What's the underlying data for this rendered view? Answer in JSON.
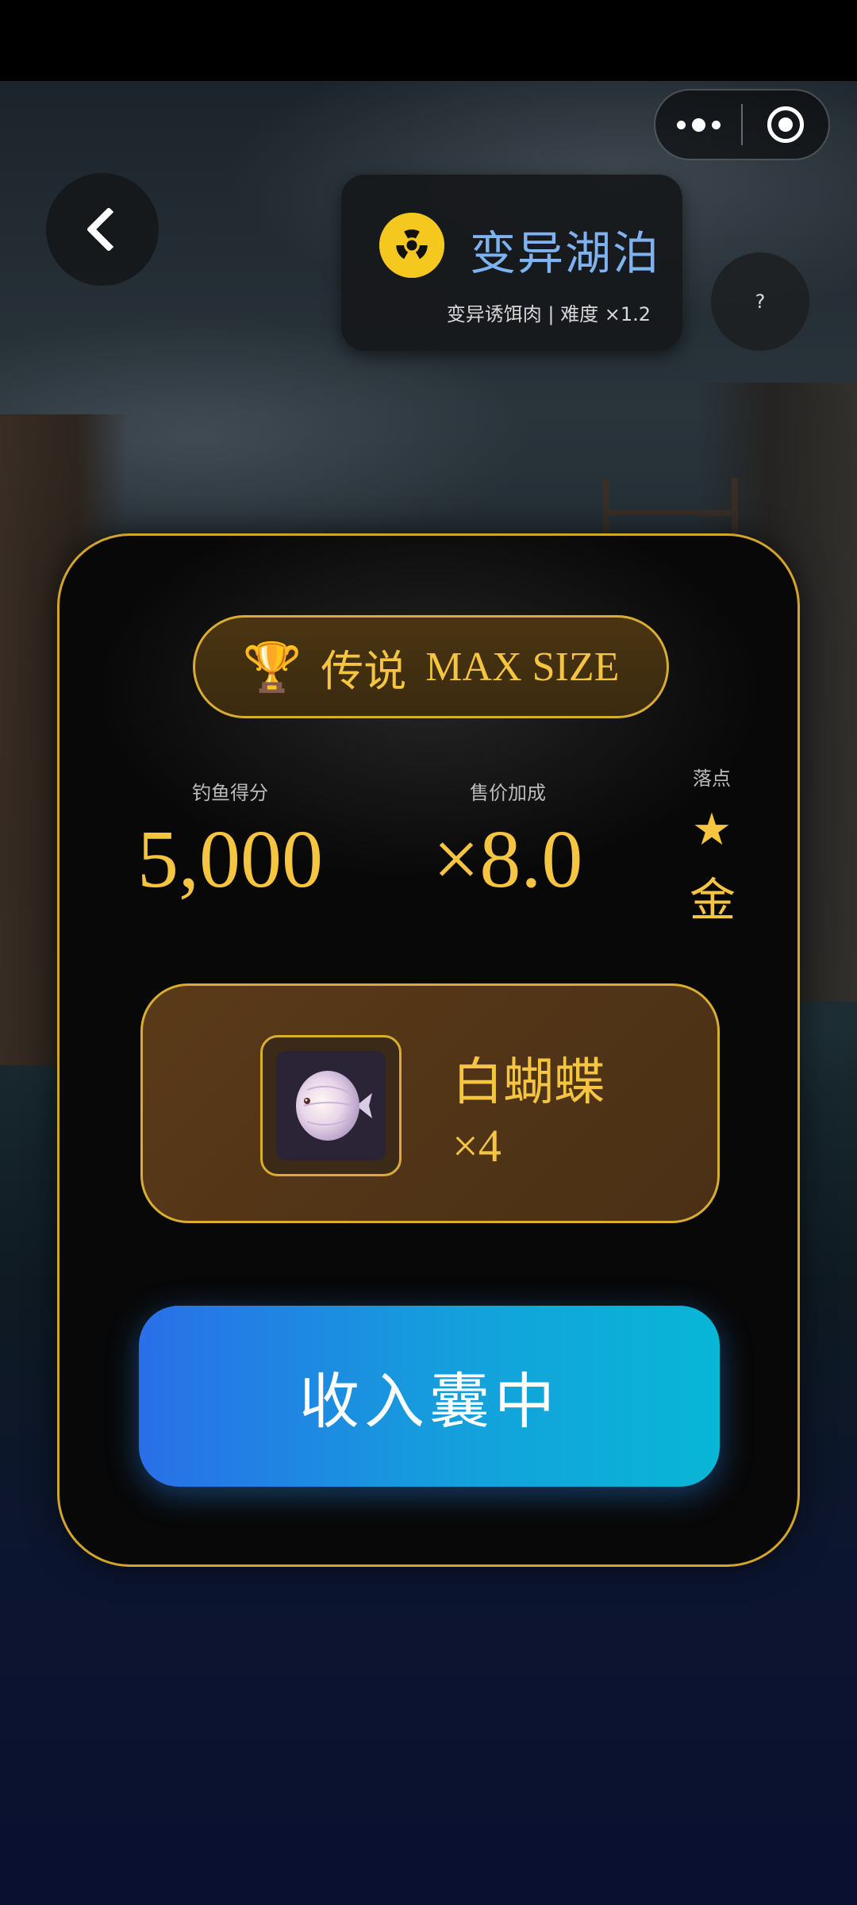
{
  "header": {
    "back_icon": "chevron-left-icon",
    "capsule": {
      "more_icon": "more-dots-icon",
      "close_icon": "target-circle-icon"
    },
    "help_label": "?"
  },
  "location": {
    "icon": "radiation-icon",
    "title": "变异湖泊",
    "subtitle": "变异诱饵肉 | 难度 ×1.2"
  },
  "result": {
    "badge": {
      "icon": "trophy-icon",
      "rank": "传说",
      "max_label": "MAX SIZE"
    },
    "stats": {
      "score_label": "钓鱼得分",
      "score_value": "5,000",
      "price_label": "售价加成",
      "price_value": "×8.0",
      "drop_label": "落点",
      "drop_star": "★",
      "drop_grade": "金"
    },
    "fish": {
      "icon": "discus-fish-icon",
      "name": "白蝴蝶",
      "quantity": "×4"
    },
    "collect_label": "收入囊中"
  },
  "colors": {
    "gold": "#f5c542",
    "title_blue": "#7fb2f0",
    "button_start": "#2a6fe8",
    "button_end": "#08b6d6"
  }
}
